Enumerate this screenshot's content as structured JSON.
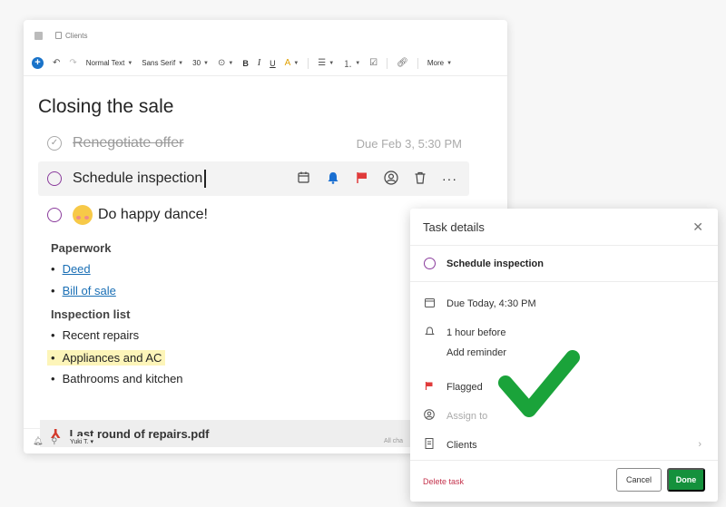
{
  "note": {
    "breadcrumb": "Clients",
    "toolbar": {
      "style": "Normal Text",
      "font": "Sans Serif",
      "size": "30",
      "more": "More"
    },
    "title": "Closing the sale",
    "tasks": [
      {
        "label": "Renegotiate offer",
        "due": "Due Feb 3, 5:30 PM",
        "done": true
      },
      {
        "label": "Schedule inspection",
        "done": false
      },
      {
        "label": "Do happy dance!",
        "done": false
      }
    ],
    "paperwork": {
      "heading": "Paperwork",
      "items": [
        "Deed",
        "Bill of sale"
      ]
    },
    "inspection": {
      "heading": "Inspection list",
      "items": [
        "Recent repairs",
        "Appliances and AC",
        "Bathrooms and kitchen"
      ]
    },
    "attachment": "Last round of repairs.pdf",
    "footer": {
      "user": "Yuki T.",
      "status": "All cha"
    }
  },
  "details": {
    "title": "Task details",
    "task": "Schedule inspection",
    "due": "Due Today, 4:30 PM",
    "reminder": "1 hour before",
    "add_reminder": "Add reminder",
    "flag": "Flagged",
    "assign_placeholder": "Assign to",
    "note": "Clients",
    "delete": "Delete task",
    "cancel": "Cancel",
    "done": "Done"
  },
  "colors": {
    "accent_purple": "#8a3b9c",
    "done_green": "#14913c",
    "flag_red": "#e03b3b",
    "link_blue": "#1a6fb5",
    "checkmark_green": "#1aa33a"
  }
}
